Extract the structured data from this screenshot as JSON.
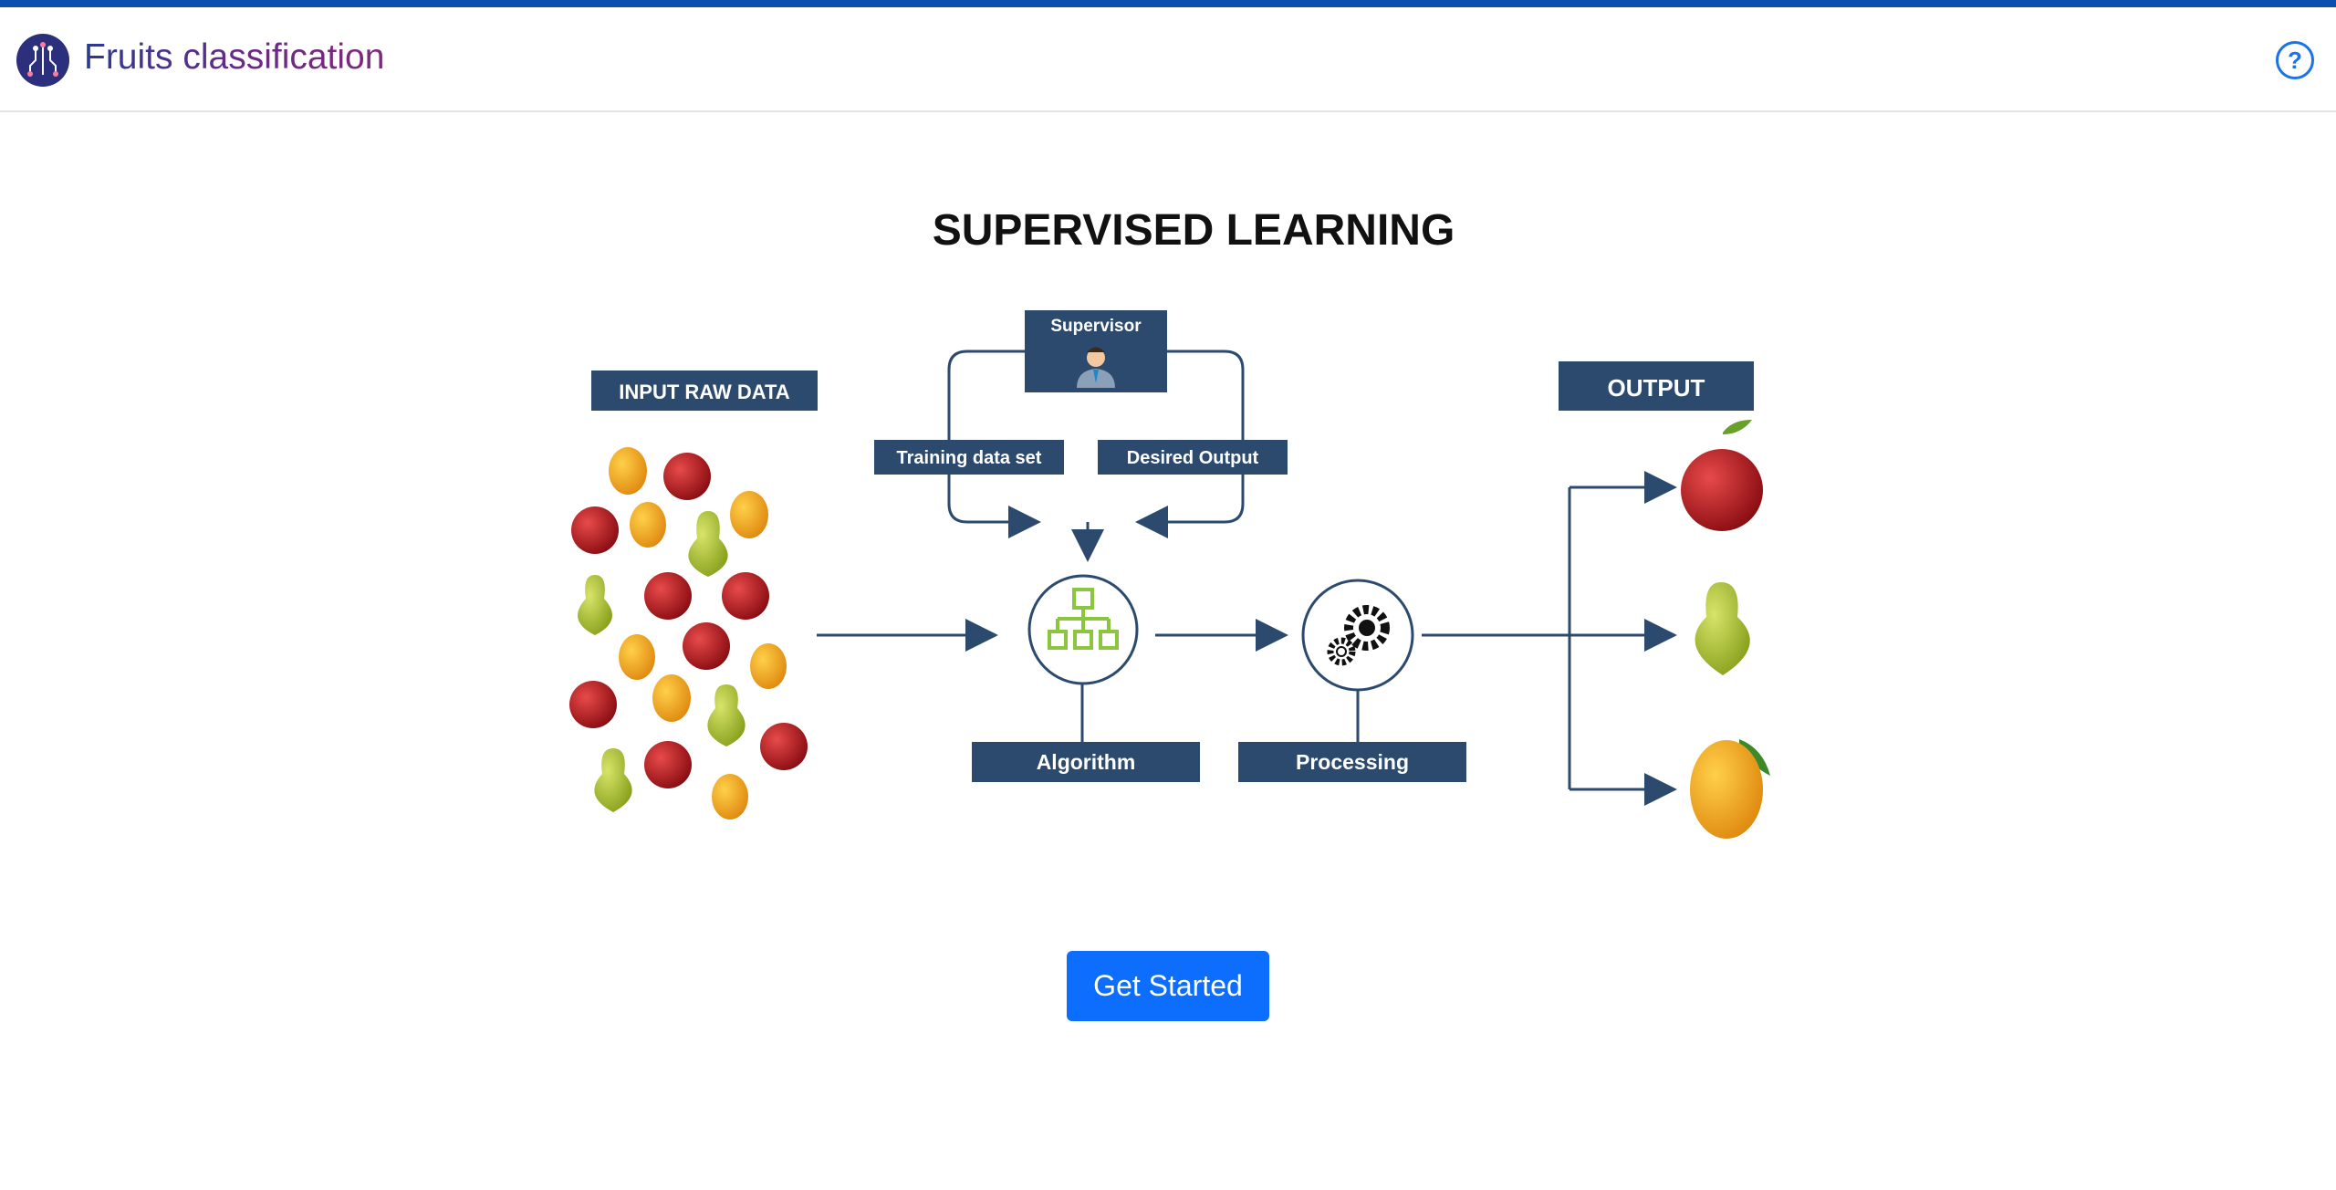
{
  "app": {
    "title": "Fruits classification"
  },
  "header": {
    "help_icon": "help-circle-icon",
    "help_glyph": "?"
  },
  "diagram": {
    "title": "SUPERVISED LEARNING",
    "input_label": "INPUT RAW DATA",
    "supervisor_label": "Supervisor",
    "training_label": "Training data set",
    "desired_label": "Desired Output",
    "algorithm_label": "Algorithm",
    "processing_label": "Processing",
    "output_label": "OUTPUT",
    "box_color": "#2c4a6e"
  },
  "actions": {
    "get_started": "Get Started"
  },
  "colors": {
    "accent": "#0d6efd",
    "topbar": "#0a4fb0"
  }
}
